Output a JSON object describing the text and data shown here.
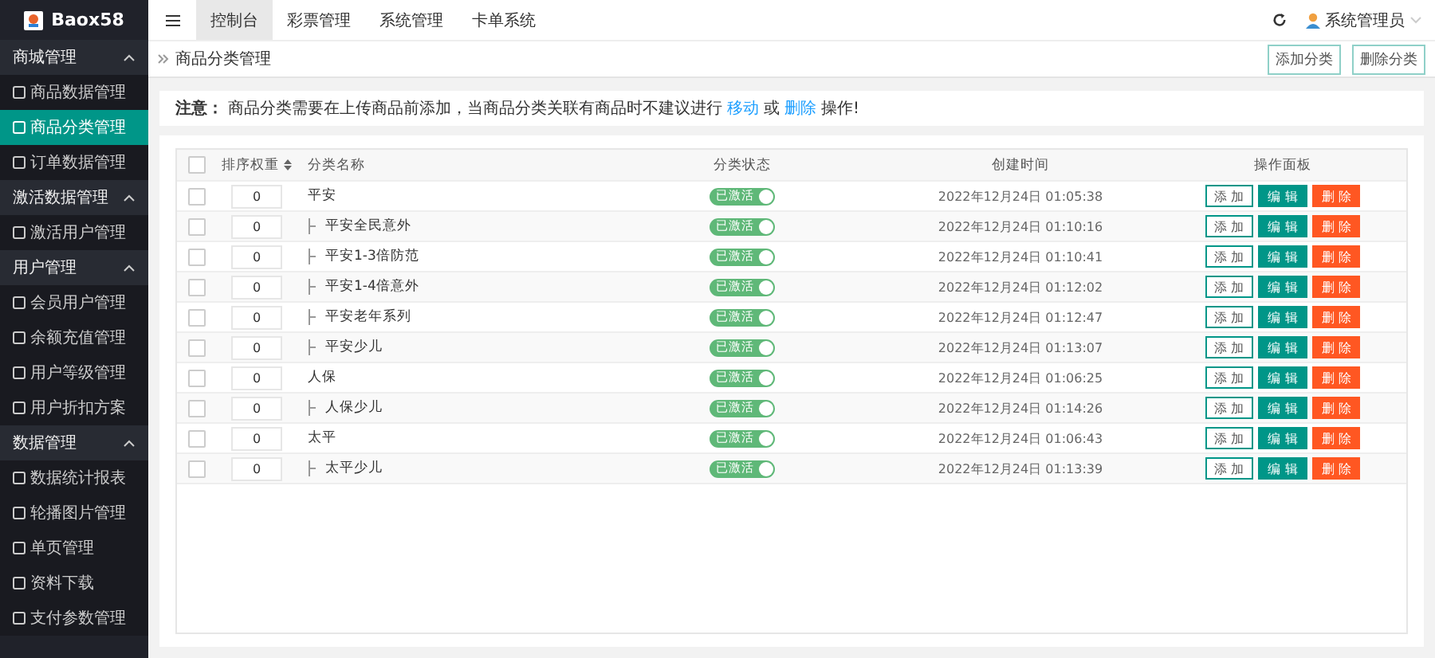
{
  "brand": {
    "name": "Baox58"
  },
  "sidebar": {
    "groups": [
      {
        "label": "商城管理",
        "expanded": true,
        "items": [
          {
            "label": "商品数据管理",
            "selected": false
          },
          {
            "label": "商品分类管理",
            "selected": true
          },
          {
            "label": "订单数据管理",
            "selected": false
          }
        ]
      },
      {
        "label": "激活数据管理",
        "expanded": true,
        "items": [
          {
            "label": "激活用户管理",
            "selected": false
          }
        ]
      },
      {
        "label": "用户管理",
        "expanded": true,
        "items": [
          {
            "label": "会员用户管理",
            "selected": false
          },
          {
            "label": "余额充值管理",
            "selected": false
          },
          {
            "label": "用户等级管理",
            "selected": false
          },
          {
            "label": "用户折扣方案",
            "selected": false
          }
        ]
      },
      {
        "label": "数据管理",
        "expanded": true,
        "items": [
          {
            "label": "数据统计报表",
            "selected": false
          },
          {
            "label": "轮播图片管理",
            "selected": false
          },
          {
            "label": "单页管理",
            "selected": false
          },
          {
            "label": "资料下载",
            "selected": false
          },
          {
            "label": "支付参数管理",
            "selected": false
          }
        ]
      }
    ]
  },
  "top_nav": {
    "tabs": [
      {
        "label": "控制台",
        "selected": true
      },
      {
        "label": "彩票管理",
        "selected": false
      },
      {
        "label": "系统管理",
        "selected": false
      },
      {
        "label": "卡单系统",
        "selected": false
      }
    ],
    "user": "系统管理员"
  },
  "breadcrumb": "商品分类管理",
  "toolbar_buttons": [
    "添加分类",
    "删除分类"
  ],
  "notice": [
    {
      "kind": "label",
      "text": "注意："
    },
    {
      "kind": "text",
      "text": "商品分类需要在上传商品前添加，当商品分类关联有商品时不建议进行"
    },
    {
      "kind": "link",
      "text": "移动"
    },
    {
      "kind": "text",
      "text": "或"
    },
    {
      "kind": "link",
      "text": "删除"
    },
    {
      "kind": "text",
      "text": "操作!"
    }
  ],
  "table": {
    "select_all_checked": false,
    "columns": [
      "排序权重",
      "分类名称",
      "分类状态",
      "创建时间",
      "操作面板"
    ],
    "rows": [
      {
        "checked": false,
        "sort": "0",
        "name": "平安",
        "status": "已激活",
        "on": true,
        "created": "2022年12月24日 01:05:38",
        "actions": [
          "添 加",
          "编 辑",
          "删 除"
        ],
        "children": [
          {
            "checked": false,
            "sort": "0",
            "name": "平安全民意外",
            "status": "已激活",
            "on": true,
            "created": "2022年12月24日 01:10:16",
            "actions": [
              "添 加",
              "编 辑",
              "删 除"
            ]
          },
          {
            "checked": false,
            "sort": "0",
            "name": "平安1-3倍防范",
            "status": "已激活",
            "on": true,
            "created": "2022年12月24日 01:10:41",
            "actions": [
              "添 加",
              "编 辑",
              "删 除"
            ]
          },
          {
            "checked": false,
            "sort": "0",
            "name": "平安1-4倍意外",
            "status": "已激活",
            "on": true,
            "created": "2022年12月24日 01:12:02",
            "actions": [
              "添 加",
              "编 辑",
              "删 除"
            ]
          },
          {
            "checked": false,
            "sort": "0",
            "name": "平安老年系列",
            "status": "已激活",
            "on": true,
            "created": "2022年12月24日 01:12:47",
            "actions": [
              "添 加",
              "编 辑",
              "删 除"
            ]
          },
          {
            "checked": false,
            "sort": "0",
            "name": "平安少儿",
            "status": "已激活",
            "on": true,
            "created": "2022年12月24日 01:13:07",
            "actions": [
              "添 加",
              "编 辑",
              "删 除"
            ]
          }
        ]
      },
      {
        "checked": false,
        "sort": "0",
        "name": "人保",
        "status": "已激活",
        "on": true,
        "created": "2022年12月24日 01:06:25",
        "actions": [
          "添 加",
          "编 辑",
          "删 除"
        ],
        "children": [
          {
            "checked": false,
            "sort": "0",
            "name": "人保少儿",
            "status": "已激活",
            "on": true,
            "created": "2022年12月24日 01:14:26",
            "actions": [
              "添 加",
              "编 辑",
              "删 除"
            ]
          }
        ]
      },
      {
        "checked": false,
        "sort": "0",
        "name": "太平",
        "status": "已激活",
        "on": true,
        "created": "2022年12月24日 01:06:43",
        "actions": [
          "添 加",
          "编 辑",
          "删 除"
        ],
        "children": [
          {
            "checked": false,
            "sort": "0",
            "name": "太平少儿",
            "status": "已激活",
            "on": true,
            "created": "2022年12月24日 01:13:39",
            "actions": [
              "添 加",
              "编 辑",
              "删 除"
            ]
          }
        ]
      }
    ]
  }
}
